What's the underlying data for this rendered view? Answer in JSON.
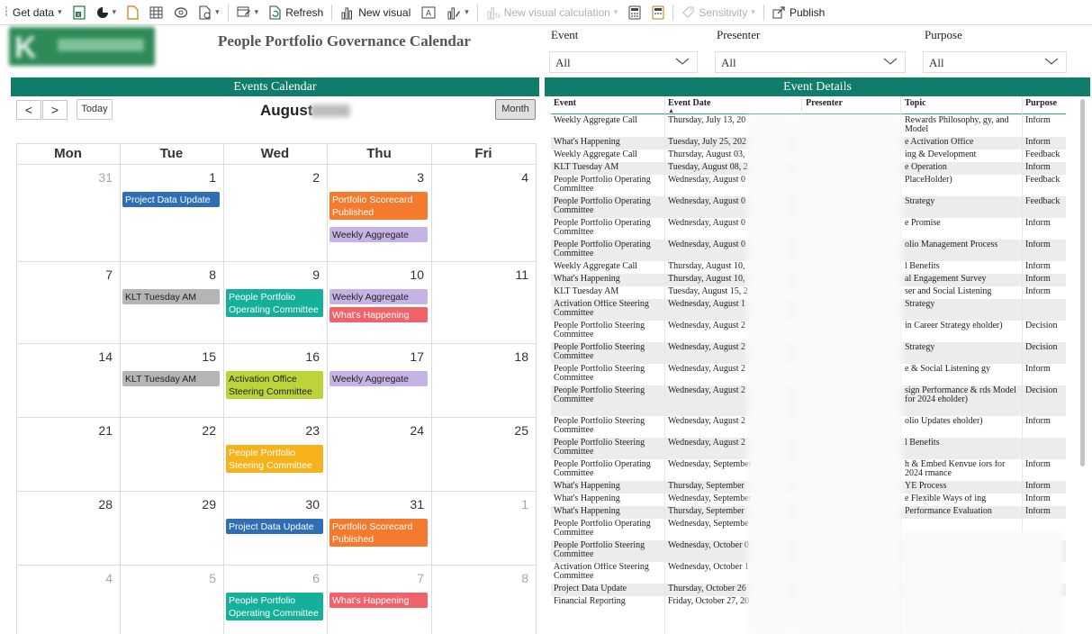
{
  "toolbar": {
    "get_data": "Get data",
    "refresh": "Refresh",
    "new_visual": "New visual",
    "new_visual_calculation": "New visual calculation",
    "sensitivity": "Sensitivity",
    "publish": "Publish"
  },
  "page": {
    "title": "People Portfolio Governance Calendar"
  },
  "filters": [
    {
      "label": "Event",
      "value": "All"
    },
    {
      "label": "Presenter",
      "value": "All"
    },
    {
      "label": "Purpose",
      "value": "All"
    }
  ],
  "calendar": {
    "header": "Events Calendar",
    "prev_label": "<",
    "next_label": ">",
    "today_label": "Today",
    "view_label": "Month",
    "month": "August",
    "weekdays": [
      "Mon",
      "Tue",
      "Wed",
      "Thu",
      "Fri"
    ],
    "weeks": [
      [
        {
          "day": "31",
          "muted": true
        },
        {
          "day": "1"
        },
        {
          "day": "2"
        },
        {
          "day": "3"
        },
        {
          "day": "4"
        }
      ],
      [
        {
          "day": "7"
        },
        {
          "day": "8"
        },
        {
          "day": "9"
        },
        {
          "day": "10"
        },
        {
          "day": "11"
        }
      ],
      [
        {
          "day": "14"
        },
        {
          "day": "15"
        },
        {
          "day": "16"
        },
        {
          "day": "17"
        },
        {
          "day": "18"
        }
      ],
      [
        {
          "day": "21"
        },
        {
          "day": "22"
        },
        {
          "day": "23"
        },
        {
          "day": "24"
        },
        {
          "day": "25"
        }
      ],
      [
        {
          "day": "28"
        },
        {
          "day": "29"
        },
        {
          "day": "30"
        },
        {
          "day": "31"
        },
        {
          "day": "1",
          "muted": true
        }
      ],
      [
        {
          "day": "4",
          "muted": true
        },
        {
          "day": "5",
          "muted": true
        },
        {
          "day": "6",
          "muted": true
        },
        {
          "day": "7",
          "muted": true
        },
        {
          "day": "8",
          "muted": true
        }
      ]
    ],
    "events": [
      {
        "week": 0,
        "day": 1,
        "slot": 0,
        "title": "Project Data Update",
        "color": "#2f6db5",
        "lines": 1
      },
      {
        "week": 0,
        "day": 3,
        "slot": 0,
        "title": "Portfolio Scorecard Published",
        "color": "#f47a2e",
        "lines": 2
      },
      {
        "week": 0,
        "day": 3,
        "slot": 2,
        "title": "Weekly Aggregate Call",
        "color": "#c5b3e6",
        "lines": 1,
        "dark": true
      },
      {
        "week": 1,
        "day": 1,
        "slot": 0,
        "title": "KLT Tuesday AM",
        "color": "#b5b5b5",
        "lines": 1,
        "dark": true
      },
      {
        "week": 1,
        "day": 2,
        "slot": 0,
        "title": "People Portfolio Operating Committee",
        "color": "#14b09a",
        "lines": 2
      },
      {
        "week": 1,
        "day": 3,
        "slot": 0,
        "title": "Weekly Aggregate Call",
        "color": "#c5b3e6",
        "lines": 1,
        "dark": true
      },
      {
        "week": 1,
        "day": 3,
        "slot": 1,
        "title": "What's Happening",
        "color": "#f0636b",
        "lines": 1
      },
      {
        "week": 2,
        "day": 1,
        "slot": 0,
        "title": "KLT Tuesday AM",
        "color": "#b5b5b5",
        "lines": 1,
        "dark": true
      },
      {
        "week": 2,
        "day": 2,
        "slot": 0,
        "title": "Activation Office Steering Committee",
        "color": "#bcd43a",
        "lines": 2,
        "dark": true
      },
      {
        "week": 2,
        "day": 3,
        "slot": 0,
        "title": "Weekly Aggregate Call",
        "color": "#c5b3e6",
        "lines": 1,
        "dark": true
      },
      {
        "week": 3,
        "day": 2,
        "slot": 0,
        "title": "People Portfolio Steering Committee",
        "color": "#f6b21a",
        "lines": 2
      },
      {
        "week": 4,
        "day": 2,
        "slot": 0,
        "title": "Project Data Update",
        "color": "#2f6db5",
        "lines": 1
      },
      {
        "week": 4,
        "day": 3,
        "slot": 0,
        "title": "Portfolio Scorecard Published",
        "color": "#f47a2e",
        "lines": 2
      },
      {
        "week": 5,
        "day": 2,
        "slot": 0,
        "title": "People Portfolio Operating Committee",
        "color": "#14b09a",
        "lines": 2
      },
      {
        "week": 5,
        "day": 3,
        "slot": 0,
        "title": "What's Happening",
        "color": "#f0636b",
        "lines": 1
      }
    ]
  },
  "details": {
    "header": "Event Details",
    "columns": [
      "Event",
      "Event Date",
      "Presenter",
      "Topic",
      "Purpose"
    ],
    "rows": [
      {
        "event": "Weekly Aggregate Call",
        "date": "Thursday, July 13, 20",
        "topic": "Rewards Philosophy, gy, and Model",
        "purpose": "Inform"
      },
      {
        "event": "What's Happening",
        "date": "Tuesday, July 25, 202",
        "topic": "e Activation Office",
        "purpose": "Inform"
      },
      {
        "event": "Weekly Aggregate Call",
        "date": "Thursday, August 03,",
        "topic": "ing & Development",
        "purpose": "Feedback"
      },
      {
        "event": "KLT Tuesday AM",
        "date": "Tuesday, August 08, 2",
        "topic": "e Operation",
        "purpose": "Inform"
      },
      {
        "event": "People Portfolio Operating Committee",
        "date": "Wednesday, August 0",
        "topic": "PlaceHolder)",
        "purpose": "Feedback"
      },
      {
        "event": "People Portfolio Operating Committee",
        "date": "Wednesday, August 0",
        "topic": "Strategy",
        "purpose": "Feedback"
      },
      {
        "event": "People Portfolio Operating Committee",
        "date": "Wednesday, August 0",
        "topic": "e Promise",
        "purpose": "Inform"
      },
      {
        "event": "People Portfolio Operating Committee",
        "date": "Wednesday, August 0",
        "topic": "olio Management Process",
        "purpose": "Inform"
      },
      {
        "event": "Weekly Aggregate Call",
        "date": "Thursday, August 10,",
        "topic": "l Benefits",
        "purpose": "Inform"
      },
      {
        "event": "What's Happening",
        "date": "Thursday, August 10,",
        "topic": "al Engagement Survey",
        "purpose": "Inform"
      },
      {
        "event": "KLT Tuesday AM",
        "date": "Tuesday, August 15, 2",
        "topic": "ser and Social Listening",
        "purpose": "Inform"
      },
      {
        "event": "Activation Office Steering Committee",
        "date": "Wednesday, August 1",
        "topic": "Strategy",
        "purpose": ""
      },
      {
        "event": "People Portfolio Steering Committee",
        "date": "Wednesday, August 2",
        "topic": "in Career Strategy eholder)",
        "purpose": "Decision"
      },
      {
        "event": "People Portfolio Steering Committee",
        "date": "Wednesday, August 2",
        "topic": "Strategy",
        "purpose": "Decision"
      },
      {
        "event": "People Portfolio Steering Committee",
        "date": "Wednesday, August 2",
        "topic": "e & Social Listening gy",
        "purpose": "Inform"
      },
      {
        "event": "People Portfolio Steering Committee",
        "date": "Wednesday, August 2",
        "topic": "sign Performance & rds Model for 2024 eholder)",
        "purpose": "Decision"
      },
      {
        "event": "People Portfolio Steering Committee",
        "date": "Wednesday, August 2",
        "topic": "olio Updates eholder)",
        "purpose": "Inform"
      },
      {
        "event": "People Portfolio Steering Committee",
        "date": "Wednesday, August 2",
        "topic": "l Benefits",
        "purpose": ""
      },
      {
        "event": "People Portfolio Operating Committee",
        "date": "Wednesday, September",
        "topic": "h & Embed Kenvue iors for 2024 rmance",
        "purpose": "Inform"
      },
      {
        "event": "What's Happening",
        "date": "Thursday, September",
        "topic": "YE Process",
        "purpose": "Inform"
      },
      {
        "event": "What's Happening",
        "date": "Wednesday, September",
        "topic": "e Flexible Ways of ing",
        "purpose": "Inform"
      },
      {
        "event": "What's Happening",
        "date": "Thursday, September",
        "topic": "Performance Evaluation",
        "purpose": "Inform"
      },
      {
        "event": "People Portfolio Operating Committee",
        "date": "Wednesday, Septembe",
        "topic": "",
        "purpose": ""
      },
      {
        "event": "People Portfolio Steering Committee",
        "date": "Wednesday, October 0",
        "topic": "",
        "purpose": ""
      },
      {
        "event": "Activation Office Steering Committee",
        "date": "Wednesday, October 1",
        "topic": "",
        "purpose": ""
      },
      {
        "event": "Project Data Update",
        "date": "Thursday, October 26",
        "topic": "",
        "purpose": ""
      },
      {
        "event": "Financial Reporting",
        "date": "Friday, October 27, 20",
        "topic": "",
        "purpose": ""
      }
    ]
  }
}
